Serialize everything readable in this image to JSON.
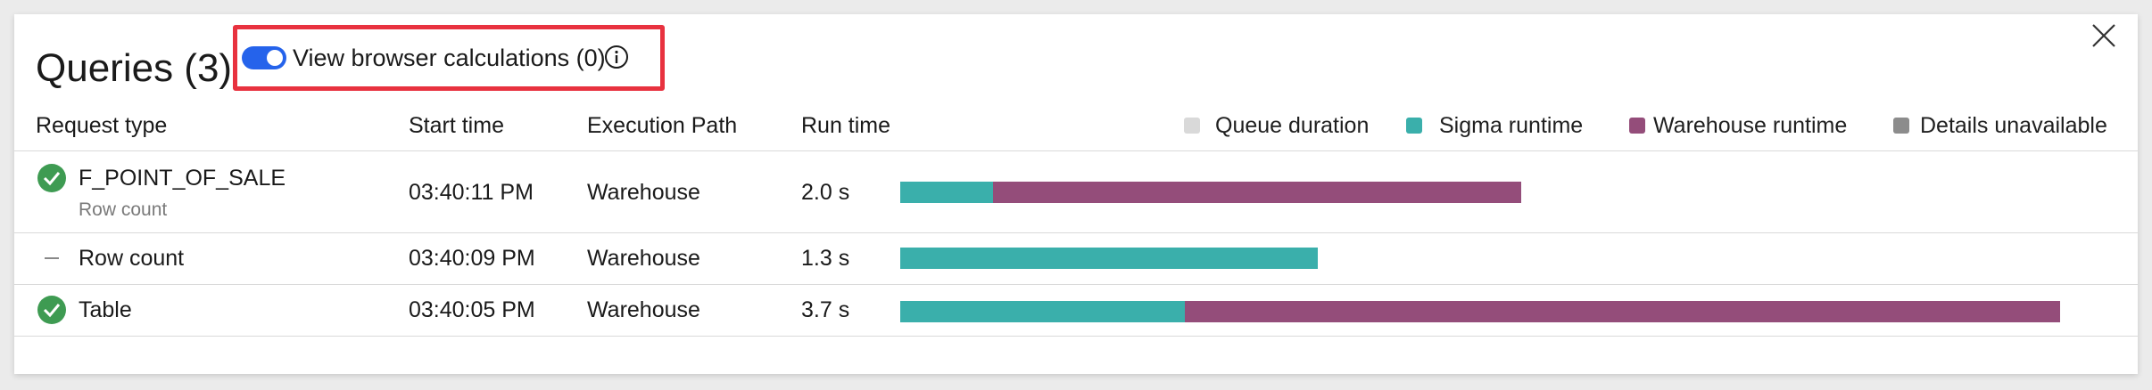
{
  "header": {
    "title": "Queries (3)",
    "toggle_label": "View browser calculations (0)",
    "toggle_on": true
  },
  "columns": {
    "request_type": "Request type",
    "start_time": "Start time",
    "execution_path": "Execution Path",
    "run_time": "Run time"
  },
  "legend": [
    {
      "label": "Queue duration",
      "color": "#d9d9d9"
    },
    {
      "label": "Sigma runtime",
      "color": "#3aafab"
    },
    {
      "label": "Warehouse runtime",
      "color": "#944d7a"
    },
    {
      "label": "Details unavailable",
      "color": "#8c8c8c"
    }
  ],
  "rows": [
    {
      "status": "success",
      "name": "F_POINT_OF_SALE",
      "subtitle": "Row count",
      "start_time": "03:40:11 PM",
      "execution_path": "Warehouse",
      "run_time": "2.0 s",
      "segments": [
        {
          "kind": "sigma",
          "fraction": 0.08
        },
        {
          "kind": "warehouse",
          "fraction": 0.455
        }
      ]
    },
    {
      "status": "none",
      "name": "Row count",
      "start_time": "03:40:09 PM",
      "execution_path": "Warehouse",
      "run_time": "1.3 s",
      "segments": [
        {
          "kind": "sigma",
          "fraction": 0.36
        }
      ]
    },
    {
      "status": "success",
      "name": "Table",
      "start_time": "03:40:05 PM",
      "execution_path": "Warehouse",
      "run_time": "3.7 s",
      "segments": [
        {
          "kind": "sigma",
          "fraction": 0.245
        },
        {
          "kind": "warehouse",
          "fraction": 0.755
        }
      ]
    }
  ],
  "colors": {
    "sigma": "#3aafab",
    "warehouse": "#944d7a",
    "toggle": "#2563eb",
    "highlight": "#e8323f",
    "success": "#3e9b52"
  }
}
